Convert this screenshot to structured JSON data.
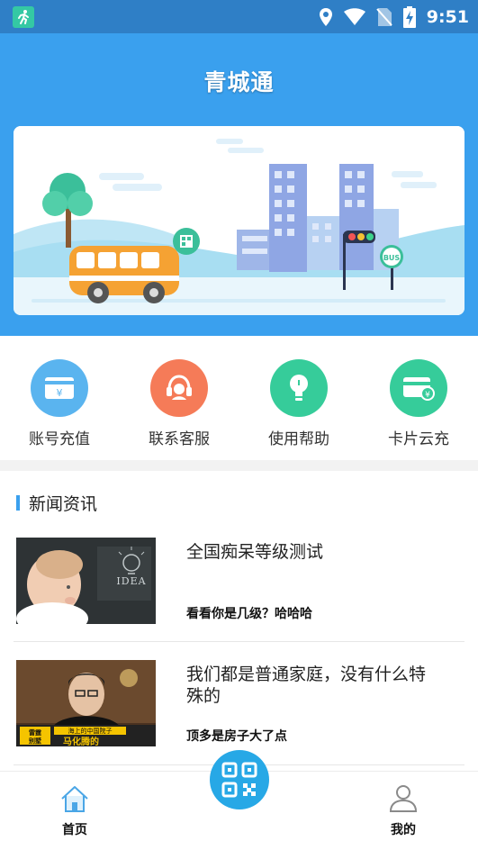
{
  "status_bar": {
    "time": "9:51"
  },
  "header": {
    "title": "青城通"
  },
  "banner": {
    "bus_sign": "BUS"
  },
  "quick_actions": [
    {
      "label": "账号充值",
      "icon": "card-yen-icon",
      "color": "#5ab4ef"
    },
    {
      "label": "联系客服",
      "icon": "headset-icon",
      "color": "#f57b58"
    },
    {
      "label": "使用帮助",
      "icon": "lightbulb-icon",
      "color": "#36cc9a"
    },
    {
      "label": "卡片云充",
      "icon": "card-cloud-icon",
      "color": "#36cc9a"
    }
  ],
  "news": {
    "section_title": "新闻资讯",
    "items": [
      {
        "title": "全国痴呆等级测试",
        "subtitle": "看看你是几级？哈哈哈",
        "image_caption": "IDEA"
      },
      {
        "title": "我们都是普通家庭，没有什么特殊的",
        "subtitle": "顶多是房子大了点",
        "image_caption_left": "雷霆别墅",
        "image_caption_right": "马化腾的",
        "image_caption_top": "海上的中国院子"
      }
    ]
  },
  "tab_bar": {
    "home_label": "首页",
    "mine_label": "我的"
  },
  "colors": {
    "primary": "#3aa0ee",
    "status_bar": "#2f7fc6",
    "scan_button": "#27a8e6"
  }
}
